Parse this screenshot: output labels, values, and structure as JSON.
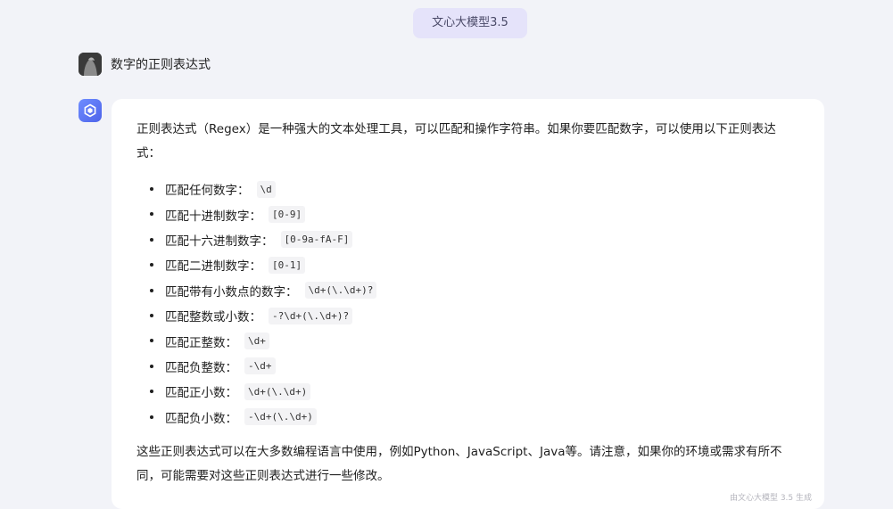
{
  "header": {
    "model_label": "文心大模型3.5"
  },
  "user": {
    "message": "数字的正则表达式"
  },
  "response": {
    "intro": "正则表达式（Regex）是一种强大的文本处理工具，可以匹配和操作字符串。如果你要匹配数字，可以使用以下正则表达式：",
    "items": [
      {
        "label": "匹配任何数字：",
        "code": "\\d"
      },
      {
        "label": "匹配十进制数字：",
        "code": "[0-9]"
      },
      {
        "label": "匹配十六进制数字：",
        "code": "[0-9a-fA-F]"
      },
      {
        "label": "匹配二进制数字：",
        "code": "[0-1]"
      },
      {
        "label": "匹配带有小数点的数字：",
        "code": "\\d+(\\.\\d+)?"
      },
      {
        "label": "匹配整数或小数：",
        "code": "-?\\d+(\\.\\d+)?"
      },
      {
        "label": "匹配正整数：",
        "code": "\\d+"
      },
      {
        "label": "匹配负整数：",
        "code": "-\\d+"
      },
      {
        "label": "匹配正小数：",
        "code": "\\d+(\\.\\d+)"
      },
      {
        "label": "匹配负小数：",
        "code": "-\\d+(\\.\\d+)"
      }
    ],
    "outro": "这些正则表达式可以在大多数编程语言中使用，例如Python、JavaScript、Java等。请注意，如果你的环境或需求有所不同，可能需要对这些正则表达式进行一些修改。",
    "footer": "由文心大模型 3.5 生成"
  },
  "icons": {
    "avatar": "user-avatar",
    "bot": "ernie-bot-icon"
  }
}
